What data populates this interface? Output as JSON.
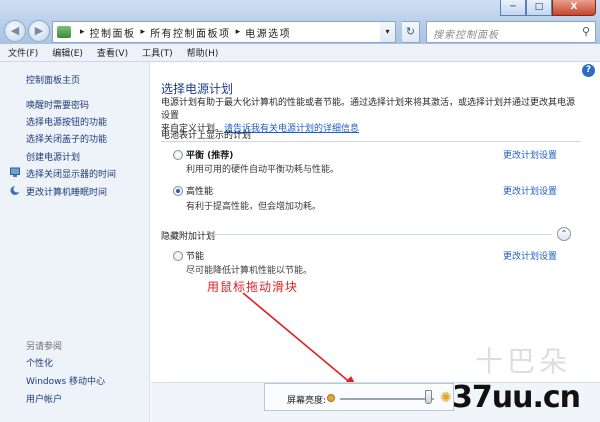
{
  "window": {
    "min": "─",
    "max": "□",
    "close": "X"
  },
  "nav": {
    "back": "◀",
    "forward": "▶"
  },
  "address": {
    "crumbs": [
      "控制面板",
      "所有控制面板项",
      "电源选项"
    ],
    "separator": "▸",
    "dropdown": "▾",
    "refresh": "↻"
  },
  "search": {
    "placeholder": "搜索控制面板"
  },
  "menu": [
    "文件(F)",
    "编辑(E)",
    "查看(V)",
    "工具(T)",
    "帮助(H)"
  ],
  "sidebar": {
    "home": "控制面板主页",
    "links": [
      "唤醒时需要密码",
      "选择电源按钮的功能",
      "选择关闭盖子的功能",
      "创建电源计划",
      "选择关闭显示器的时间",
      "更改计算机睡眠时间"
    ],
    "see_also_title": "另请参阅",
    "see_also": [
      "个性化",
      "Windows 移动中心",
      "用户帐户"
    ]
  },
  "main": {
    "help": "?",
    "title": "选择电源计划",
    "desc_line1": "电源计划有助于最大化计算机的性能或者节能。通过选择计划来将其激活，或选择计划并通过更改其电源设置",
    "desc_line2_prefix": "来自定义计划。",
    "desc_link": "请告诉我有关电源计划的详细信息",
    "battery_section": "电池表计上显示的计划",
    "plans": [
      {
        "name": "平衡",
        "suffix": " (推荐)",
        "desc": "利用可用的硬件自动平衡功耗与性能。",
        "link": "更改计划设置",
        "selected": false
      },
      {
        "name": "高性能",
        "suffix": "",
        "desc": "有利于提高性能，但会增加功耗。",
        "link": "更改计划设置",
        "selected": true
      }
    ],
    "hidden_section": "隐藏附加计划",
    "hidden_chevron": "⌃",
    "hidden_plans": [
      {
        "name": "节能",
        "desc": "尽可能降低计算机性能以节能。",
        "link": "更改计划设置",
        "selected": false
      }
    ]
  },
  "annotation": "用鼠标拖动滑块",
  "brightness": {
    "label": "屏幕亮度:",
    "level": 0.95
  },
  "watermark": "37uu.cn"
}
